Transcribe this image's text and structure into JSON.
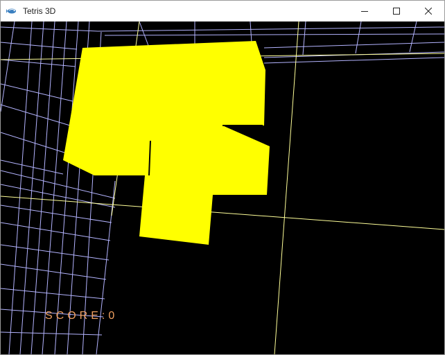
{
  "window": {
    "title": "Tetris 3D",
    "icon": "fish-app-icon",
    "controls": [
      "minimize-icon",
      "maximize-icon",
      "close-icon"
    ]
  },
  "game": {
    "score_text": "SCORE:0",
    "colors": {
      "background": "#000000",
      "grid_lines": "#b4b4ff",
      "axis_lines": "#ffff99",
      "piece": "#ffff00",
      "score": "#f0a060"
    }
  }
}
